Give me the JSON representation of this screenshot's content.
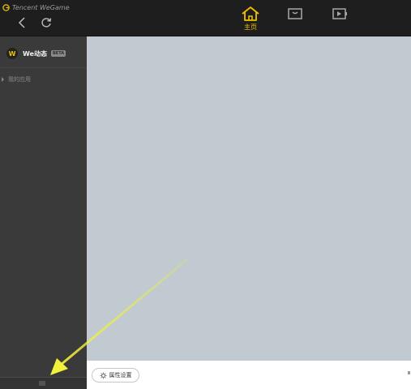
{
  "app": {
    "brand": "Tencent WeGame"
  },
  "tabs": [
    {
      "id": "home",
      "label": "主页",
      "icon": "home-icon",
      "active": true
    },
    {
      "id": "store",
      "label": "",
      "icon": "store-icon",
      "active": false
    },
    {
      "id": "video",
      "label": "",
      "icon": "video-icon",
      "active": false
    }
  ],
  "sidebar": {
    "we_logo": "W",
    "we_title": "We动态",
    "beta_badge": "BETA",
    "my_apps_label": "我的应用"
  },
  "bottom": {
    "settings_label": "属性设置"
  },
  "colors": {
    "accent": "#f0c000",
    "content_bg": "#c1c9d1",
    "arrow": "#f2f23a"
  }
}
